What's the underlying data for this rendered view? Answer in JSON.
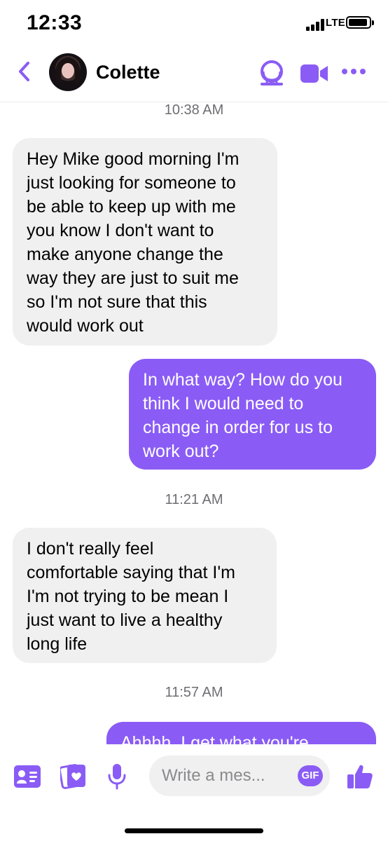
{
  "status_bar": {
    "time": "12:33",
    "network": "LTE"
  },
  "header": {
    "contact_name": "Colette",
    "back_icon": "chevron-left-icon",
    "actions": [
      "audio-call-icon",
      "video-call-icon",
      "more-icon"
    ]
  },
  "conversation": {
    "timestamps": [
      "10:38 AM",
      "11:21 AM",
      "11:57 AM"
    ],
    "messages": [
      {
        "direction": "incoming",
        "text": "Hey Mike good morning I'm\njust looking for someone to\nbe able to keep up with me\nyou know I don't want to\nmake anyone change the\nway they are just to suit me\nso I'm not sure that this\nwould work out"
      },
      {
        "direction": "outgoing",
        "text": "In what way? How do you\nthink I would need to\nchange in order for us to\nwork out?"
      },
      {
        "direction": "incoming",
        "text": "I don't really feel\ncomfortable saying that I'm\nI'm not trying to be mean I\njust want to live a healthy\nlong life"
      },
      {
        "direction": "outgoing",
        "text": "Ahhhh. I get what you're"
      }
    ]
  },
  "composer": {
    "placeholder": "Write a mes...",
    "gif_label": "GIF",
    "icons": [
      "contact-card-icon",
      "photo-gallery-icon",
      "microphone-icon",
      "like-thumb-icon"
    ]
  },
  "colors": {
    "accent": "#8a5cf5",
    "incoming_bubble": "#f0f0f0"
  }
}
